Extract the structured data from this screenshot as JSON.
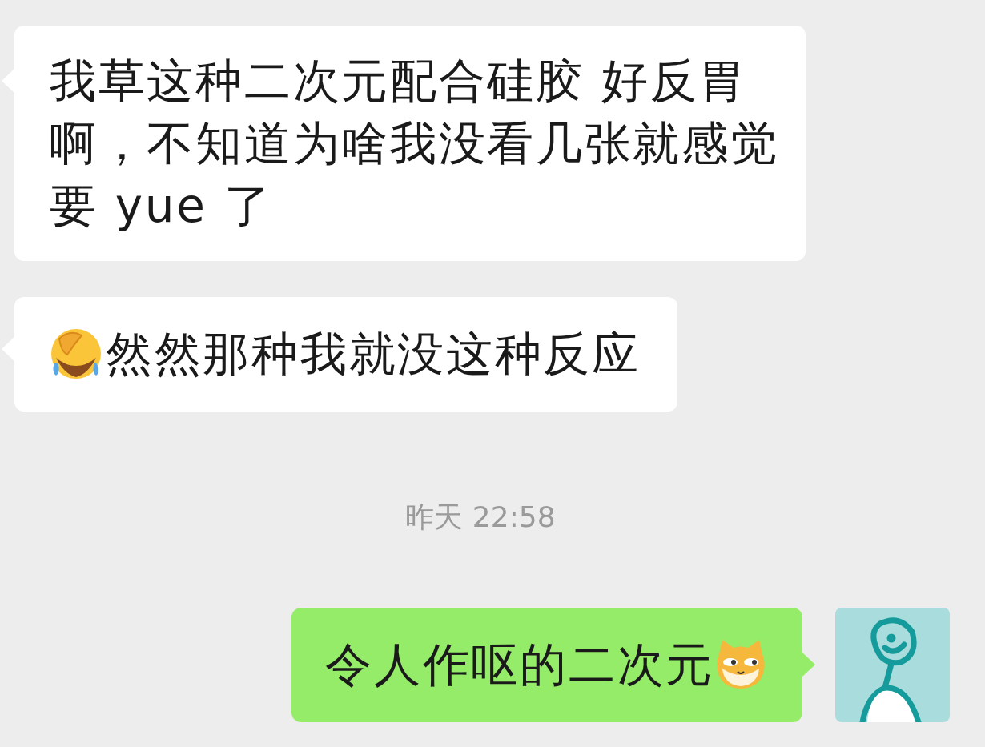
{
  "messages": [
    {
      "kind": "incoming",
      "parts": [
        {
          "kind": "text",
          "text": "我草这种二次元配合硅胶 好反胃啊，不知道为啥我没看几张就感觉要 yue 了"
        }
      ]
    },
    {
      "kind": "incoming",
      "parts": [
        {
          "kind": "emoji"
        },
        {
          "kind": "text",
          "text": "然然那种我就没这种反应"
        }
      ]
    },
    {
      "kind": "time",
      "text": "昨天 22:58"
    },
    {
      "kind": "outgoing",
      "parts": [
        {
          "kind": "text",
          "text": "令人作呕的二次元"
        },
        {
          "kind": "emoji"
        }
      ]
    }
  ]
}
